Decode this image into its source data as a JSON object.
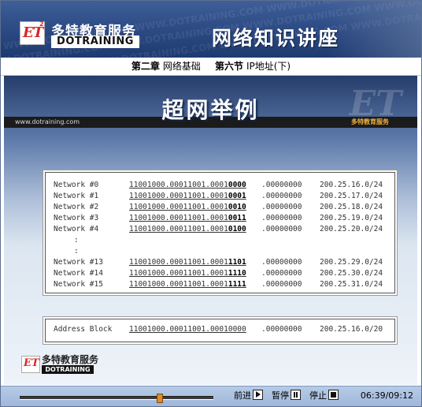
{
  "banner": {
    "brand_cn": "多特教育服务",
    "brand_en": "DOTRAINING",
    "logo_text": "ET",
    "logo_sup": "2",
    "course_title": "网络知识讲座"
  },
  "chapter": {
    "chapter_label": "第二章",
    "chapter_name": "网络基础",
    "section_label": "第六节",
    "section_name": "IP地址(下)"
  },
  "slide": {
    "title": "超网举例",
    "url": "www.dotraining.com",
    "tag": "多特教育服务",
    "networks": [
      {
        "label": "Network #0",
        "bin_prefix": "11001000.00011001.0001",
        "bin_bold": "0000",
        "tail": ".00000000",
        "cidr": "200.25.16.0/24"
      },
      {
        "label": "Network #1",
        "bin_prefix": "11001000.00011001.0001",
        "bin_bold": "0001",
        "tail": ".00000000",
        "cidr": "200.25.17.0/24"
      },
      {
        "label": "Network #2",
        "bin_prefix": "11001000.00011001.0001",
        "bin_bold": "0010",
        "tail": ".00000000",
        "cidr": "200.25.18.0/24"
      },
      {
        "label": "Network #3",
        "bin_prefix": "11001000.00011001.0001",
        "bin_bold": "0011",
        "tail": ".00000000",
        "cidr": "200.25.19.0/24"
      },
      {
        "label": "Network #4",
        "bin_prefix": "11001000.00011001.0001",
        "bin_bold": "0100",
        "tail": ".00000000",
        "cidr": "200.25.20.0/24"
      },
      {
        "label": "Network #13",
        "bin_prefix": "11001000.00011001.0001",
        "bin_bold": "1101",
        "tail": ".00000000",
        "cidr": "200.25.29.0/24"
      },
      {
        "label": "Network #14",
        "bin_prefix": "11001000.00011001.0001",
        "bin_bold": "1110",
        "tail": ".00000000",
        "cidr": "200.25.30.0/24"
      },
      {
        "label": "Network #15",
        "bin_prefix": "11001000.00011001.0001",
        "bin_bold": "1111",
        "tail": ".00000000",
        "cidr": "200.25.31.0/24"
      }
    ],
    "ellipsis": ":",
    "address_block": {
      "label": "Address Block",
      "bin": "11001000.00011001.0001",
      "bin_rest": "0000",
      "tail": ".00000000",
      "cidr": "200.25.16.0/20"
    },
    "footer_brand_cn": "多特教育服务",
    "footer_brand_en": "DOTRAINING",
    "footer_logo": "ET"
  },
  "player": {
    "next_label": "前进",
    "pause_label": "暂停",
    "stop_label": "停止",
    "time": "06:39/09:12",
    "progress": 0.72
  }
}
